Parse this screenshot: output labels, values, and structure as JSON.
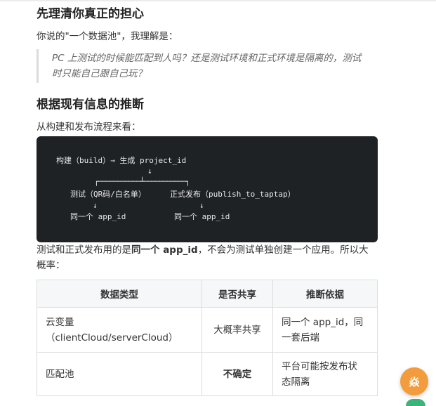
{
  "section1": {
    "heading": "先理清你真正的担心",
    "intro": "你说的\"一个数据池\"，我理解是：",
    "quote_line1": "PC 上测试的时候能匹配到人吗？还是测试环境和正式环境是隔离的，测试",
    "quote_line2": "时只能自己跟自己玩？"
  },
  "section2": {
    "heading": "根据现有信息的推断",
    "intro": "从构建和发布流程来看：",
    "code_lines": [
      "构建（build）→ 生成 project_id",
      "↓",
      "┌───────────┴───────────┐",
      "测试（QR码/白名单）",
      "正式发布（publish_to_taptap）",
      "↓",
      "↓",
      "同一个 app_id",
      "同一个 app_id"
    ],
    "conclusion_pre": "测试和正式发布用的是",
    "conclusion_bold": "同一个 app_id",
    "conclusion_post": "，不会为测试单独创建一个应用。所以大",
    "conclusion_line2": "概率："
  },
  "table": {
    "headers": [
      "数据类型",
      "是否共享",
      "推断依据"
    ],
    "rows": [
      {
        "type_line1": "云变量",
        "type_line2": "（clientCloud/serverCloud）",
        "shared": "大概率共享",
        "basis_line1": "同一个 app_id，同",
        "basis_line2": "一套后端"
      },
      {
        "type_line1": "匹配池",
        "shared": "不确定",
        "basis_line1": "平台可能按发布状",
        "basis_line2": "态隔离"
      }
    ]
  },
  "fab": {
    "label": "焱",
    "color": "#f39c3d"
  },
  "colors": {
    "code_bg": "#1f2225",
    "quote_border": "#dcdcdc",
    "table_header_bg": "#f6f7f8"
  }
}
